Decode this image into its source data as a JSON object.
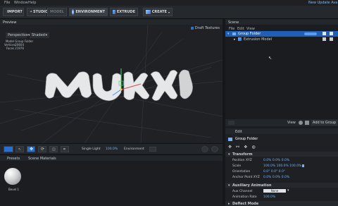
{
  "menu": {
    "file": "File",
    "window": "Window",
    "help": "Help",
    "notice": "New Update Ava"
  },
  "toolbar": {
    "import": "IMPORT",
    "studio": "STUDIO",
    "model": "MODEL",
    "environment": "ENVIRONMENT",
    "extrude": "EXTRUDE",
    "create": "CREATE"
  },
  "preview": {
    "title": "Preview",
    "draft_textures": "Draft Textures",
    "camera": "Perspective",
    "shading": "Shaded",
    "info": {
      "model_label": "Model",
      "model_value": "Group Folder",
      "vertices_label": "Vertices",
      "vertices_value": "20604",
      "faces_label": "Faces",
      "faces_value": "21976"
    }
  },
  "viewport_toolbar": {
    "lighting": "Single Light",
    "lighting_value": "100.0%",
    "environment": "Environment"
  },
  "lower": {
    "tab_presets": "Presets",
    "tab_scene_materials": "Scene Materials",
    "material_name": "Bevel 1"
  },
  "scene": {
    "title": "Scene",
    "tabs": [
      "File",
      "Edit",
      "View"
    ],
    "items": [
      {
        "label": "Group Folder",
        "selected": true
      },
      {
        "label": "Extrusion Model",
        "selected": false
      }
    ],
    "view_label": "View",
    "add_to_group": "Add to Group"
  },
  "edit": {
    "title": "Edit",
    "object_name": "Group Folder",
    "transform_title": "Transform",
    "position_label": "Position XYZ",
    "position_value": "0.0%  0.0%  0.0%",
    "scale_label": "Scale",
    "scale_value": "100.0%  100.0%  100.0%",
    "orientation_label": "Orientation",
    "orientation_value": "0.0°  0.0°  0.0°",
    "anchor_label": "Anchor Point XYZ",
    "anchor_value": "0.0%  0.0%  0.0%",
    "aux_title": "Auxiliary Animation",
    "aux_channel_label": "Aux Channel",
    "aux_channel_value": "None",
    "anim_rate_label": "Animation Rate",
    "anim_rate_value": "100.0%",
    "deflect_title": "Deflect Mode"
  },
  "colors": {
    "accent": "#2a6fd0",
    "selection": "#1f5fb8",
    "panel": "#25282c"
  }
}
